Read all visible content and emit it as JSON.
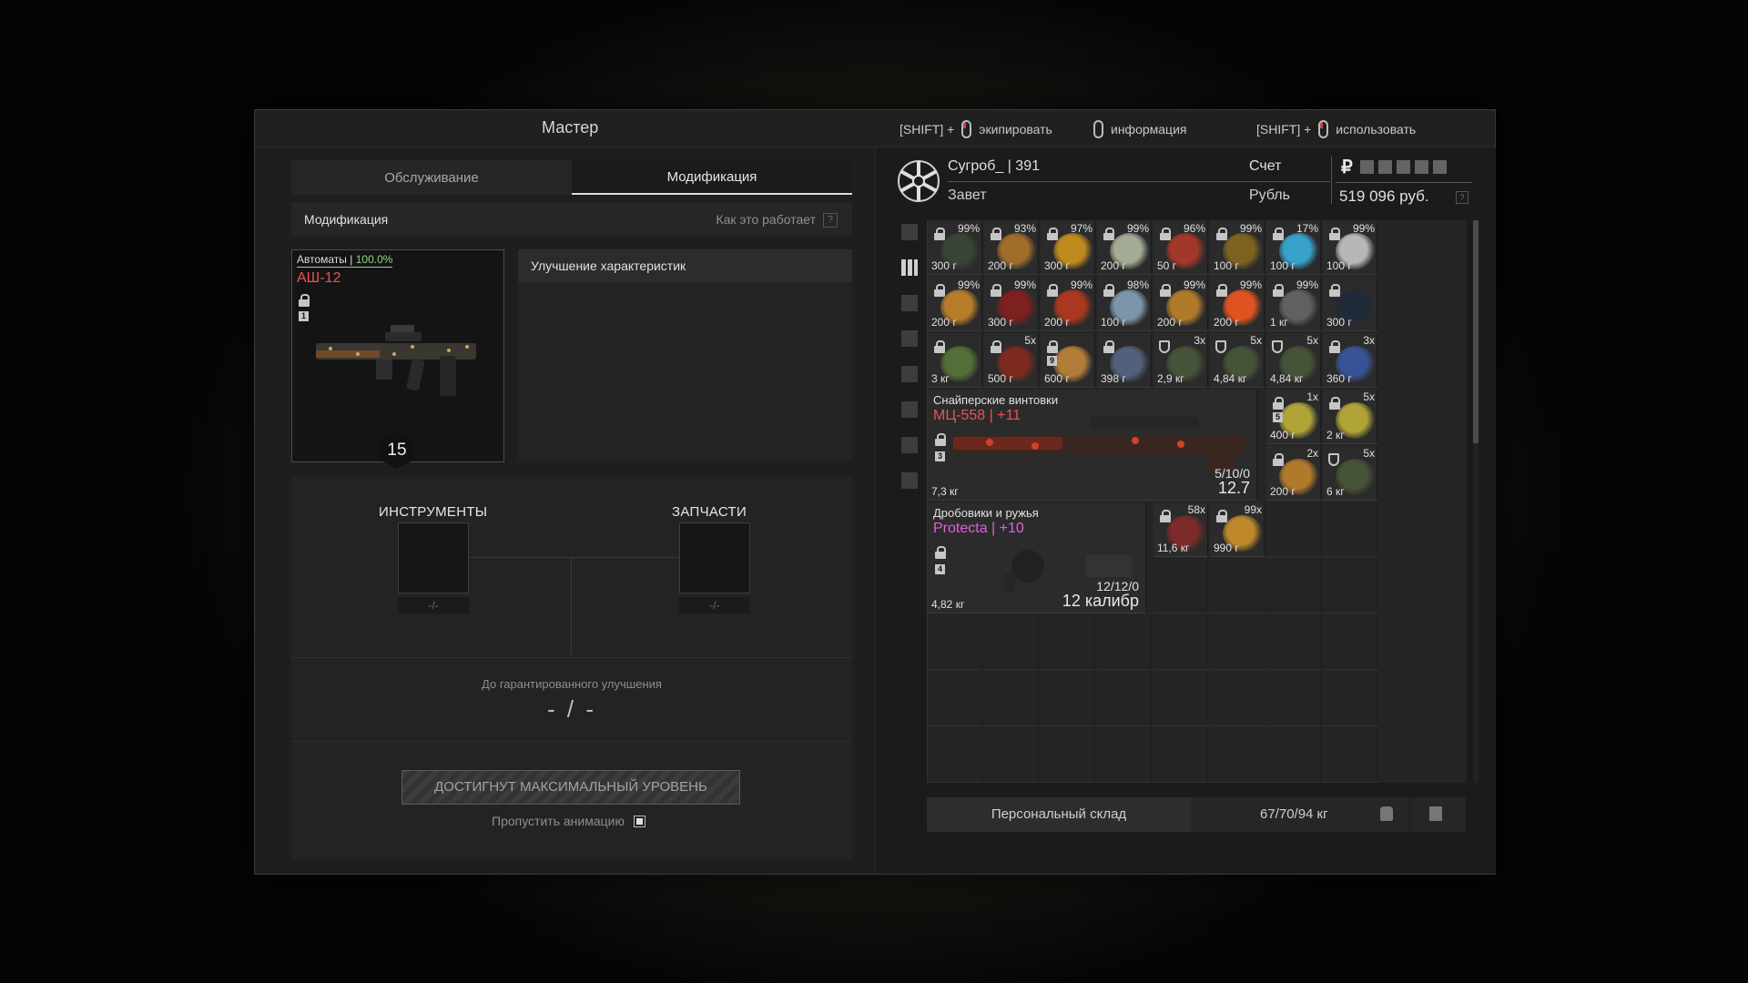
{
  "window": {
    "title": "Мастер"
  },
  "hints": [
    {
      "prefix": "[SHIFT] +",
      "label": "экипировать"
    },
    {
      "prefix": "",
      "label": "информация"
    },
    {
      "prefix": "[SHIFT] +",
      "label": "использовать"
    }
  ],
  "tabs": [
    {
      "label": "Обслуживание"
    },
    {
      "label": "Модификация"
    }
  ],
  "modification": {
    "header": "Модификация",
    "how_it_works": "Как это работает",
    "help": "?",
    "weapon": {
      "category": "Автоматы |",
      "percent": "100.0%",
      "name": "АШ-12",
      "tag": "1",
      "level": "15"
    },
    "improvement_header": "Улучшение характеристик",
    "tools_label": "ИНСТРУМЕНТЫ",
    "parts_label": "ЗАПЧАСТИ",
    "tools_value": "-/-",
    "parts_value": "-/-",
    "guaranteed_label": "До гарантированного улучшения",
    "guaranteed_value": "- / -",
    "max_button": "ДОСТИГНУТ МАКСИМАЛЬНЫЙ УРОВЕНЬ",
    "skip_label": "Пропустить анимацию"
  },
  "player": {
    "name": "Сугроб_ | 391",
    "faction": "Завет",
    "account_label": "Счет",
    "currency_label": "Рубль",
    "money": "519 096 руб.",
    "currency_symbol": "₽",
    "help": "?"
  },
  "sidebar_icons": [
    "sort-icon",
    "grid-icon",
    "rifle-icon",
    "knife-icon",
    "artifact-icon",
    "camera-icon",
    "tools-icon",
    "box-icon"
  ],
  "inventory": [
    {
      "pct": "99%",
      "w": "300 г",
      "lock": true,
      "c": "#3b4a38"
    },
    {
      "pct": "93%",
      "w": "200 г",
      "lock": true,
      "c": "#b5782a"
    },
    {
      "pct": "97%",
      "w": "300 г",
      "lock": true,
      "c": "#d89a1c"
    },
    {
      "pct": "99%",
      "w": "200 г",
      "lock": true,
      "c": "#b8c2a8"
    },
    {
      "pct": "96%",
      "w": "50 г",
      "lock": true,
      "c": "#b83a2a"
    },
    {
      "pct": "99%",
      "w": "100 г",
      "lock": true,
      "c": "#8a6e1e"
    },
    {
      "pct": "17%",
      "w": "100 г",
      "lock": true,
      "c": "#3ab6e8"
    },
    {
      "pct": "99%",
      "w": "100 г",
      "lock": true,
      "c": "#d0d0d0"
    },
    {
      "pct": "99%",
      "w": "200 г",
      "lock": true,
      "c": "#d08a2a"
    },
    {
      "pct": "99%",
      "w": "300 г",
      "lock": true,
      "c": "#8a1e1e"
    },
    {
      "pct": "99%",
      "w": "200 г",
      "lock": true,
      "c": "#c03a1e"
    },
    {
      "pct": "98%",
      "w": "100 г",
      "lock": true,
      "c": "#8aa8c0"
    },
    {
      "pct": "99%",
      "w": "200 г",
      "lock": true,
      "c": "#c8882a"
    },
    {
      "pct": "99%",
      "w": "200 г",
      "lock": true,
      "c": "#ff5a1e"
    },
    {
      "pct": "99%",
      "w": "1 кг",
      "lock": true,
      "c": "#6a6a6a"
    },
    {
      "pct": "",
      "w": "300 г",
      "lock": true,
      "c": "#1e2a3a"
    },
    {
      "pct": "",
      "w": "3 кг",
      "lock": true,
      "c": "#5a7a3a"
    },
    {
      "cnt": "5x",
      "w": "500 г",
      "lock": true,
      "c": "#8a2a1e"
    },
    {
      "cnt": "",
      "w": "600 г",
      "lock": true,
      "tag": "9",
      "c": "#c88a3a"
    },
    {
      "cnt": "",
      "w": "398 г",
      "lock": true,
      "c": "#5a6a8a"
    },
    {
      "cnt": "3x",
      "w": "2,9 кг",
      "shield": true,
      "c": "#4a5a3a"
    },
    {
      "cnt": "5x",
      "w": "4,84 кг",
      "shield": true,
      "c": "#4a5a3a"
    },
    {
      "cnt": "5x",
      "w": "4,84 кг",
      "shield": true,
      "c": "#4a5a3a"
    },
    {
      "cnt": "3x",
      "w": "360 г",
      "lock": true,
      "c": "#3a5aa8"
    },
    {
      "cnt": "1x",
      "w": "400 г",
      "lock": true,
      "tag": "5",
      "c": "#c8b83a"
    },
    {
      "cnt": "5x",
      "w": "2 кг",
      "lock": true,
      "c": "#c8b83a"
    },
    {
      "cnt": "2x",
      "w": "200 г",
      "lock": true,
      "c": "#c8882a"
    },
    {
      "cnt": "5x",
      "w": "6 кг",
      "shield": true,
      "c": "#4a5a3a"
    },
    {
      "cnt": "58x",
      "w": "11,6 кг",
      "lock": true,
      "c": "#8a2a2a"
    },
    {
      "cnt": "99x",
      "w": "990 г",
      "lock": true,
      "c": "#d8982a"
    }
  ],
  "sniper": {
    "category": "Снайперские винтовки",
    "name": "МЦ-558 | +11",
    "tag": "3",
    "ammo": "5/10/0",
    "caliber": "12.7",
    "weight": "7,3 кг",
    "color": "#e85454"
  },
  "shotgun": {
    "category": "Дробовики и ружья",
    "name": "Protecta | +10",
    "tag": "4",
    "ammo": "12/12/0",
    "caliber": "12 калибр",
    "weight": "4,82 кг",
    "color": "#e060d8"
  },
  "storage": {
    "label": "Персональный склад",
    "weight": "67/70/94 кг"
  }
}
